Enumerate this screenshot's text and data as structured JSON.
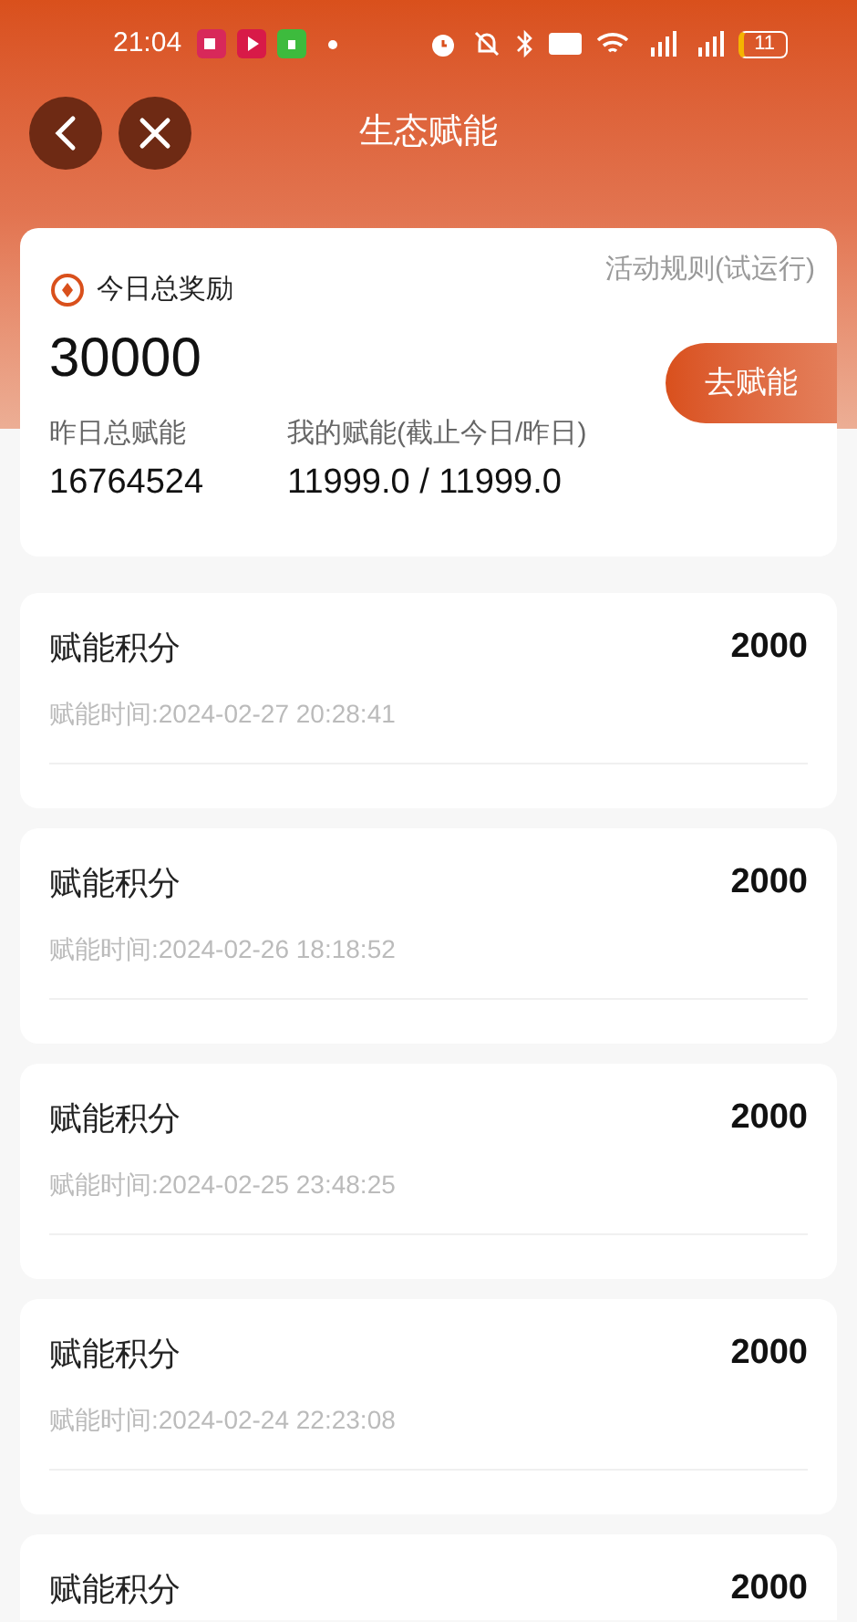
{
  "status_bar": {
    "time": "21:04",
    "battery": "11"
  },
  "header": {
    "title": "生态赋能"
  },
  "summary": {
    "label": "今日总奖励",
    "rules_link": "活动规则(试运行)",
    "total": "30000",
    "action": "去赋能",
    "stats": [
      {
        "label": "昨日总赋能",
        "value": "16764524"
      },
      {
        "label": "我的赋能(截止今日/昨日)",
        "value": "11999.0 / 11999.0"
      }
    ]
  },
  "records": [
    {
      "title": "赋能积分",
      "amount": "2000",
      "time": "赋能时间:2024-02-27 20:28:41"
    },
    {
      "title": "赋能积分",
      "amount": "2000",
      "time": "赋能时间:2024-02-26 18:18:52"
    },
    {
      "title": "赋能积分",
      "amount": "2000",
      "time": "赋能时间:2024-02-25 23:48:25"
    },
    {
      "title": "赋能积分",
      "amount": "2000",
      "time": "赋能时间:2024-02-24 22:23:08"
    },
    {
      "title": "赋能积分",
      "amount": "2000"
    }
  ]
}
